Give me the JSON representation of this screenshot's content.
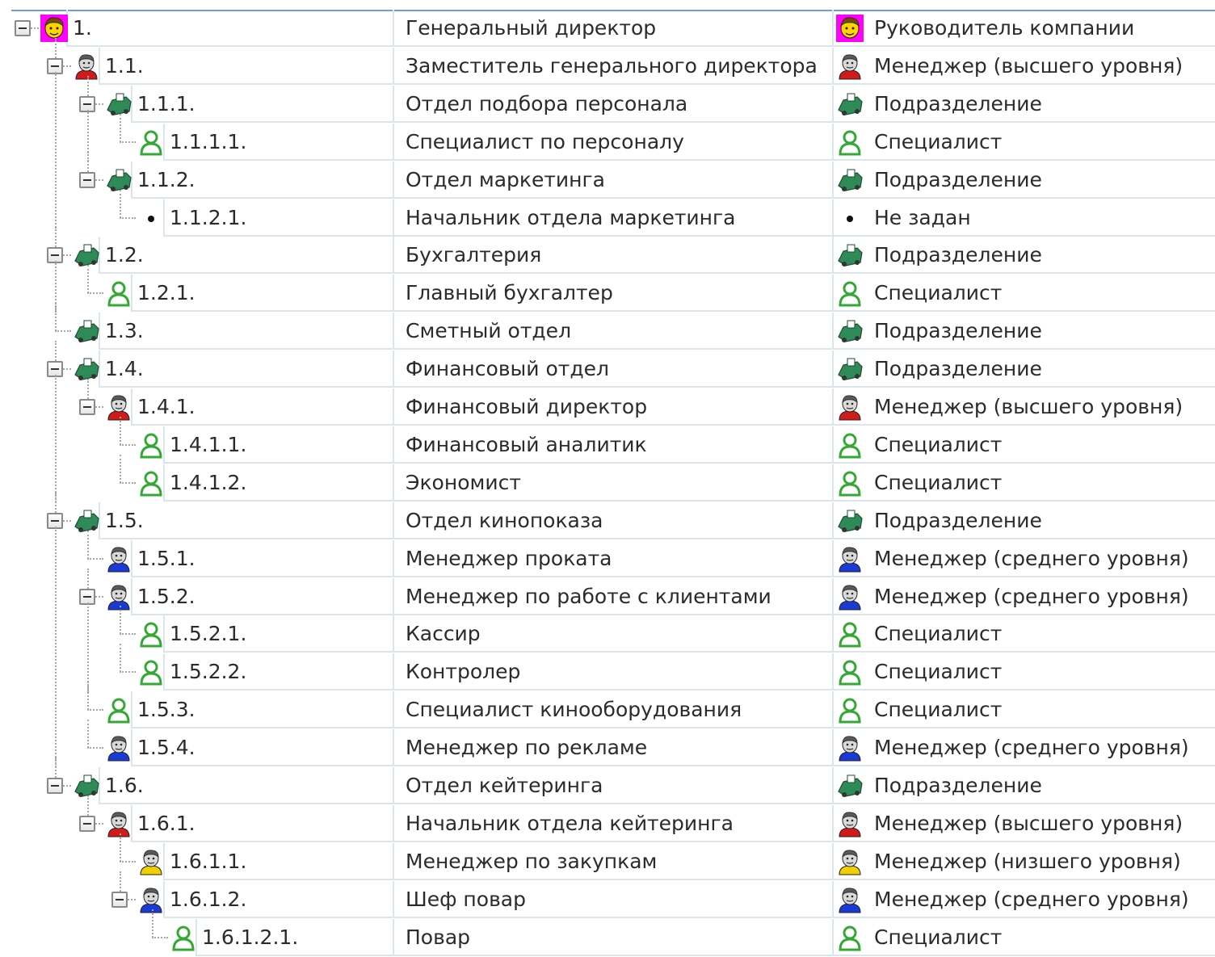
{
  "colors": {
    "grid_line": "#dbe5ee",
    "header_line": "#6aa0d8",
    "tree_line": "#a8a8a8",
    "text": "#2b2b2b",
    "role_red": "#d11a1a",
    "role_blue": "#1a3ad6",
    "role_yellow": "#f2d000",
    "department_green": "#2e8b57",
    "specialist_green": "#33a933",
    "director_magenta": "#ff00ff"
  },
  "rows": [
    {
      "num": "1.",
      "name": "Генеральный директор",
      "type": "Руководитель компании",
      "icon": "director-icon",
      "level": 0,
      "expanded": true
    },
    {
      "num": "1.1.",
      "name": "Заместитель генерального директора",
      "type": "Менеджер (высшего уровня)",
      "icon": "manager-high-icon",
      "level": 1,
      "expanded": true
    },
    {
      "num": "1.1.1.",
      "name": "Отдел подбора персонала",
      "type": "Подразделение",
      "icon": "department-icon",
      "level": 2,
      "expanded": true
    },
    {
      "num": "1.1.1.1.",
      "name": "Специалист по персоналу",
      "type": "Специалист",
      "icon": "specialist-icon",
      "level": 3,
      "expanded": false
    },
    {
      "num": "1.1.2.",
      "name": "Отдел маркетинга",
      "type": "Подразделение",
      "icon": "department-icon",
      "level": 2,
      "expanded": true
    },
    {
      "num": "1.1.2.1.",
      "name": "Начальник отдела маркетинга",
      "type": "Не задан",
      "icon": "bullet-icon",
      "level": 3,
      "expanded": false
    },
    {
      "num": "1.2.",
      "name": "Бухгалтерия",
      "type": "Подразделение",
      "icon": "department-icon",
      "level": 1,
      "expanded": true
    },
    {
      "num": "1.2.1.",
      "name": "Главный бухгалтер",
      "type": "Специалист",
      "icon": "specialist-icon",
      "level": 2,
      "expanded": false
    },
    {
      "num": "1.3.",
      "name": "Сметный отдел",
      "type": "Подразделение",
      "icon": "department-icon",
      "level": 1,
      "expanded": false
    },
    {
      "num": "1.4.",
      "name": "Финансовый отдел",
      "type": "Подразделение",
      "icon": "department-icon",
      "level": 1,
      "expanded": true
    },
    {
      "num": "1.4.1.",
      "name": "Финансовый директор",
      "type": "Менеджер (высшего уровня)",
      "icon": "manager-high-icon",
      "level": 2,
      "expanded": true
    },
    {
      "num": "1.4.1.1.",
      "name": "Финансовый аналитик",
      "type": "Специалист",
      "icon": "specialist-icon",
      "level": 3,
      "expanded": false
    },
    {
      "num": "1.4.1.2.",
      "name": "Экономист",
      "type": "Специалист",
      "icon": "specialist-icon",
      "level": 3,
      "expanded": false
    },
    {
      "num": "1.5.",
      "name": "Отдел кинопоказа",
      "type": "Подразделение",
      "icon": "department-icon",
      "level": 1,
      "expanded": true
    },
    {
      "num": "1.5.1.",
      "name": "Менеджер проката",
      "type": "Менеджер (среднего уровня)",
      "icon": "manager-mid-icon",
      "level": 2,
      "expanded": false
    },
    {
      "num": "1.5.2.",
      "name": "Менеджер по работе с клиентами",
      "type": "Менеджер (среднего уровня)",
      "icon": "manager-mid-icon",
      "level": 2,
      "expanded": true
    },
    {
      "num": "1.5.2.1.",
      "name": "Кассир",
      "type": "Специалист",
      "icon": "specialist-icon",
      "level": 3,
      "expanded": false
    },
    {
      "num": "1.5.2.2.",
      "name": "Контролер",
      "type": "Специалист",
      "icon": "specialist-icon",
      "level": 3,
      "expanded": false
    },
    {
      "num": "1.5.3.",
      "name": "Специалист кинооборудования",
      "type": "Специалист",
      "icon": "specialist-icon",
      "level": 2,
      "expanded": false
    },
    {
      "num": "1.5.4.",
      "name": "Менеджер по рекламе",
      "type": "Менеджер (среднего уровня)",
      "icon": "manager-mid-icon",
      "level": 2,
      "expanded": false
    },
    {
      "num": "1.6.",
      "name": "Отдел кейтеринга",
      "type": "Подразделение",
      "icon": "department-icon",
      "level": 1,
      "expanded": true
    },
    {
      "num": "1.6.1.",
      "name": "Начальник отдела кейтеринга",
      "type": "Менеджер (высшего уровня)",
      "icon": "manager-high-icon",
      "level": 2,
      "expanded": true
    },
    {
      "num": "1.6.1.1.",
      "name": "Менеджер по закупкам",
      "type": "Менеджер (низшего уровня)",
      "icon": "manager-low-icon",
      "level": 3,
      "expanded": false
    },
    {
      "num": "1.6.1.2.",
      "name": "Шеф повар",
      "type": "Менеджер (среднего уровня)",
      "icon": "manager-mid-icon",
      "level": 3,
      "expanded": true
    },
    {
      "num": "1.6.1.2.1.",
      "name": "Повар",
      "type": "Специалист",
      "icon": "specialist-icon",
      "level": 4,
      "expanded": false
    }
  ]
}
